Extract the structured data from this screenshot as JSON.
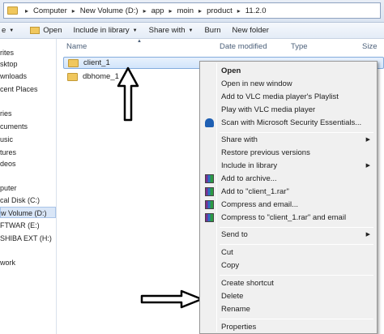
{
  "address": {
    "crumbs": [
      "Computer",
      "New Volume (D:)",
      "app",
      "moin",
      "product",
      "11.2.0"
    ]
  },
  "toolbar": {
    "organize_partial": "e",
    "open": "Open",
    "include_in_library": "Include in library",
    "share_with": "Share with",
    "burn": "Burn",
    "new_folder": "New folder"
  },
  "nav": {
    "items": [
      "rites",
      "sktop",
      "wnloads",
      "cent Places",
      "ries",
      "cuments",
      "usic",
      "tures",
      "deos",
      "puter",
      "cal Disk (C:)",
      "w Volume (D:)",
      "FTWAR (E:)",
      "SHIBA EXT (H:)",
      "work"
    ]
  },
  "columns": {
    "name": "Name",
    "date_modified": "Date modified",
    "type": "Type",
    "size": "Size"
  },
  "files": [
    {
      "name": "client_1",
      "selected": true
    },
    {
      "name": "dbhome_1",
      "selected": false
    }
  ],
  "context_menu": {
    "open": "Open",
    "open_new_window": "Open in new window",
    "add_vlc_playlist": "Add to VLC media player's Playlist",
    "play_vlc": "Play with VLC media player",
    "scan_mse": "Scan with Microsoft Security Essentials...",
    "share_with": "Share with",
    "restore_prev": "Restore previous versions",
    "include_library": "Include in library",
    "add_archive": "Add to archive...",
    "add_client_rar": "Add to \"client_1.rar\"",
    "compress_email": "Compress and email...",
    "compress_client_rar_email": "Compress to \"client_1.rar\" and email",
    "send_to": "Send to",
    "cut": "Cut",
    "copy": "Copy",
    "create_shortcut": "Create shortcut",
    "delete": "Delete",
    "rename": "Rename",
    "properties": "Properties"
  },
  "icons": {
    "submenu": "triangle-right-icon",
    "winrar": "winrar-icon",
    "mse": "security-shield-icon"
  },
  "colors": {
    "selection": "#d2e5fb",
    "menu_bg": "#f0f0f0",
    "folder": "#f0c75d"
  }
}
